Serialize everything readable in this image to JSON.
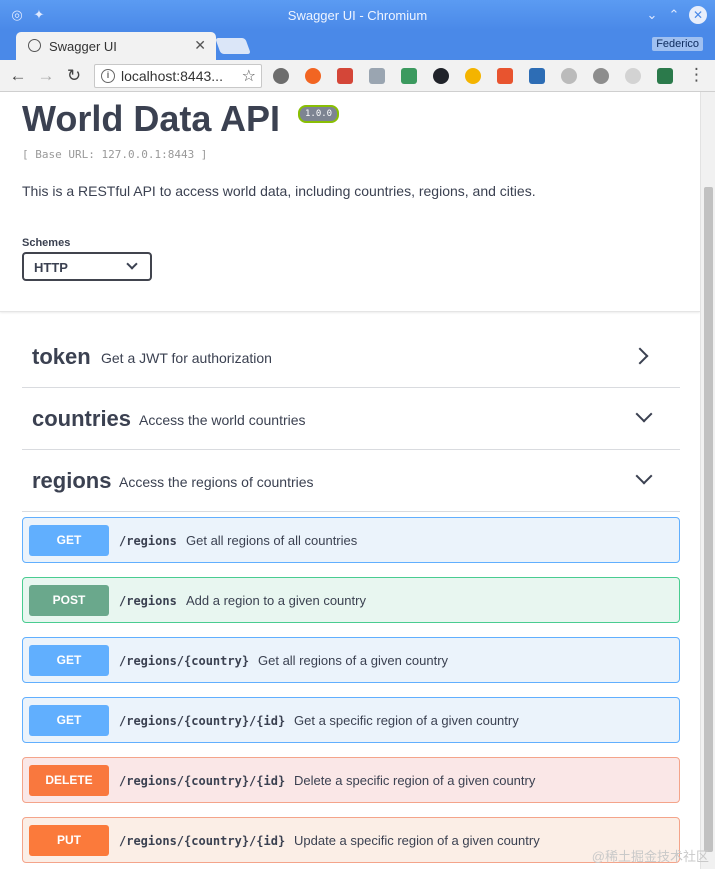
{
  "window": {
    "title": "Swagger UI - Chromium",
    "profile": "Federico"
  },
  "tab": {
    "label": "Swagger UI"
  },
  "toolbar": {
    "url": "localhost:8443..."
  },
  "info": {
    "title": "World Data API",
    "version": "1.0.0",
    "base_url": "[ Base URL: 127.0.0.1:8443 ]",
    "description": "This is a RESTful API to access world data, including countries, regions, and cities.",
    "schemes_label": "Schemes",
    "schemes_value": "HTTP"
  },
  "tags": [
    {
      "name": "token",
      "description": "Get a JWT for authorization"
    },
    {
      "name": "countries",
      "description": "Access the world countries"
    },
    {
      "name": "regions",
      "description": "Access the regions of countries"
    }
  ],
  "operations": [
    {
      "method": "GET",
      "path": "/regions",
      "summary": "Get all regions of all countries"
    },
    {
      "method": "POST",
      "path": "/regions",
      "summary": "Add a region to a given country"
    },
    {
      "method": "GET",
      "path": "/regions/{country}",
      "summary": "Get all regions of a given country"
    },
    {
      "method": "GET",
      "path": "/regions/{country}/{id}",
      "summary": "Get a specific region of a given country"
    },
    {
      "method": "DELETE",
      "path": "/regions/{country}/{id}",
      "summary": "Delete a specific region of a given country"
    },
    {
      "method": "PUT",
      "path": "/regions/{country}/{id}",
      "summary": "Update a specific region of a given country"
    }
  ],
  "watermark": "@稀土掘金技术社区",
  "colors": {
    "get": "#61affe",
    "post": "#49cc90",
    "delete": "#f93e3e",
    "put": "#fca130",
    "titlebar": "#4a89e8"
  }
}
